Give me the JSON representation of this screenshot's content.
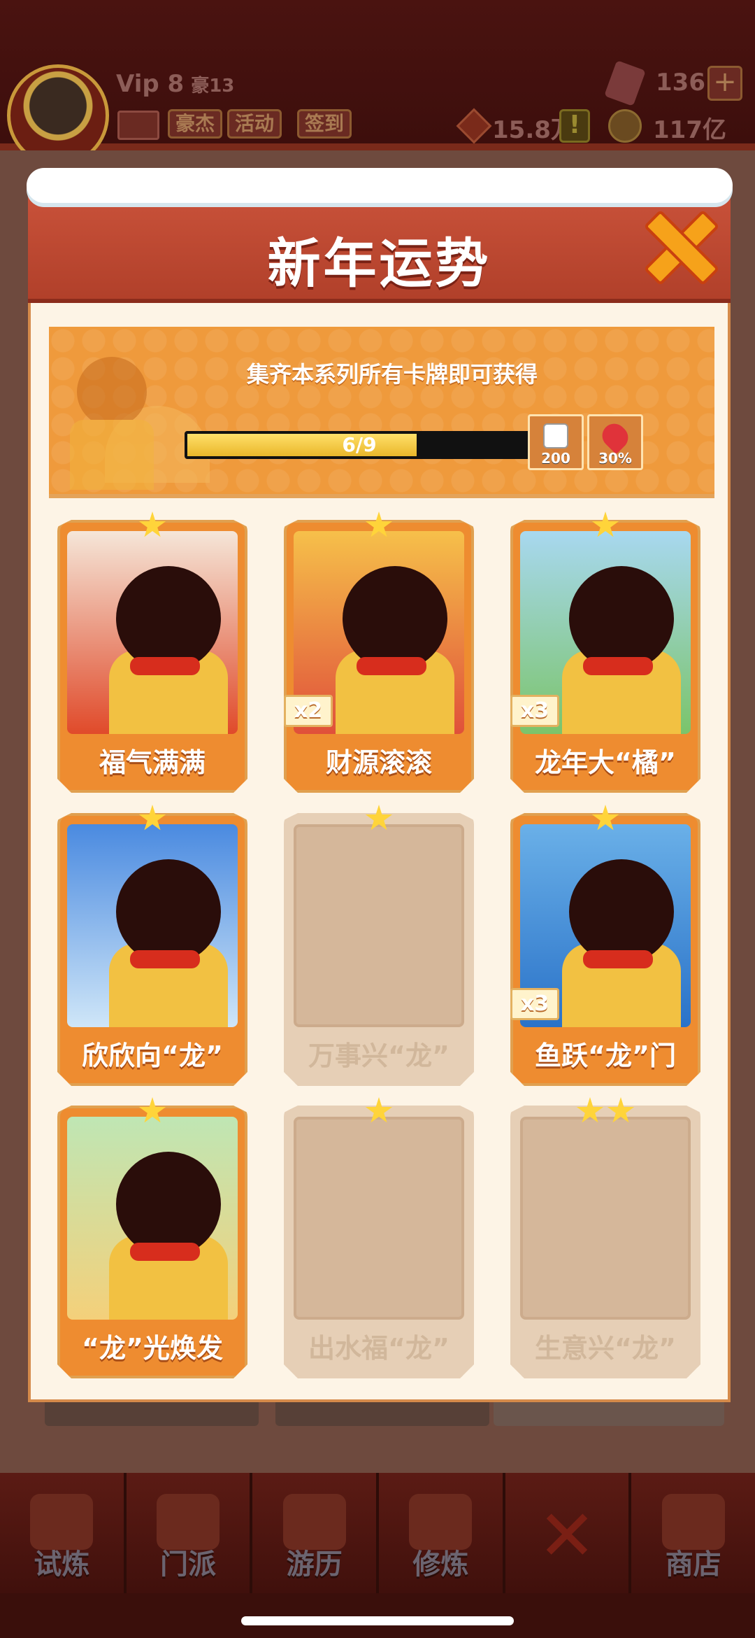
{
  "header": {
    "vip": "Vip 8",
    "vip_rank": "豪13",
    "chips": [
      "豪杰",
      "活动",
      "签到"
    ],
    "gems": "136",
    "tokens": "15.8万",
    "coins": "117亿",
    "plus": "+",
    "alert": "!"
  },
  "modal": {
    "title": "新年运势",
    "banner_text": "集齐本系列所有卡牌即可获得",
    "progress": {
      "text": "6/9",
      "collected": 6,
      "total": 9
    },
    "rewards": [
      {
        "icon": "dice-icon",
        "label": "200"
      },
      {
        "icon": "heart-icon",
        "label": "30%"
      }
    ],
    "cards": [
      {
        "name": "福气满满",
        "stars": 1,
        "count": "",
        "collected": true
      },
      {
        "name": "财源滚滚",
        "stars": 1,
        "count": "x2",
        "collected": true
      },
      {
        "name": "龙年大“橘”",
        "stars": 1,
        "count": "x3",
        "collected": true
      },
      {
        "name": "欣欣向“龙”",
        "stars": 1,
        "count": "",
        "collected": true
      },
      {
        "name": "万事兴“龙”",
        "stars": 1,
        "count": "",
        "collected": false
      },
      {
        "name": "鱼跃“龙”门",
        "stars": 1,
        "count": "x3",
        "collected": true
      },
      {
        "name": "“龙”光焕发",
        "stars": 1,
        "count": "",
        "collected": true
      },
      {
        "name": "出水福“龙”",
        "stars": 1,
        "count": "",
        "collected": false
      },
      {
        "name": "生意兴“龙”",
        "stars": 2,
        "count": "",
        "collected": false
      }
    ]
  },
  "bottom_nav": [
    {
      "label": "试炼"
    },
    {
      "label": "门派"
    },
    {
      "label": "游历"
    },
    {
      "label": "修炼"
    },
    {
      "label": ""
    },
    {
      "label": "商店"
    }
  ],
  "colors": {
    "accent_orange": "#ee8c30",
    "header_red": "#c9523a",
    "star_gold": "#ffd43a"
  }
}
